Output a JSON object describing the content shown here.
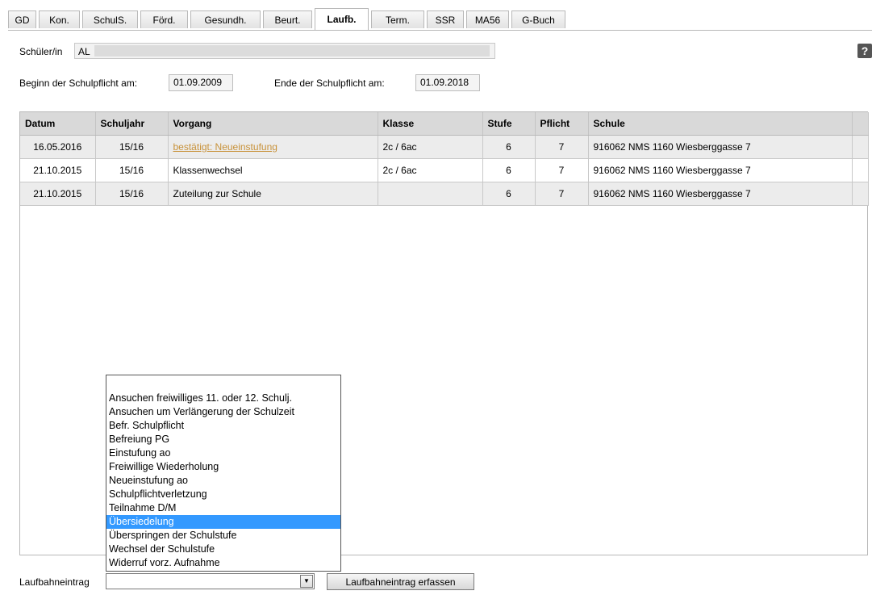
{
  "tabs": [
    {
      "label": "GD"
    },
    {
      "label": "Kon."
    },
    {
      "label": "SchulS."
    },
    {
      "label": "Förd."
    },
    {
      "label": "Gesundh."
    },
    {
      "label": "Beurt."
    },
    {
      "label": "Laufb."
    },
    {
      "label": "Term."
    },
    {
      "label": "SSR"
    },
    {
      "label": "MA56"
    },
    {
      "label": "G-Buch"
    }
  ],
  "active_tab": "Laufb.",
  "student": {
    "label": "Schüler/in",
    "value": "AL"
  },
  "help_icon": "?",
  "schulpflicht": {
    "begin_label": "Beginn der Schulpflicht am:",
    "begin_value": "01.09.2009",
    "end_label": "Ende der Schulpflicht am:",
    "end_value": "01.09.2018"
  },
  "table": {
    "columns": [
      "Datum",
      "Schuljahr",
      "Vorgang",
      "Klasse",
      "Stufe",
      "Pflicht",
      "Schule"
    ],
    "rows": [
      {
        "datum": "16.05.2016",
        "schuljahr": "15/16",
        "vorgang": "bestätigt: Neueinstufung",
        "klasse": "2c / 6ac",
        "stufe": "6",
        "pflicht": "7",
        "schule": "916062 NMS 1160 Wiesberggasse 7"
      },
      {
        "datum": "21.10.2015",
        "schuljahr": "15/16",
        "vorgang": "Klassenwechsel",
        "klasse": "2c / 6ac",
        "stufe": "6",
        "pflicht": "7",
        "schule": "916062 NMS 1160 Wiesberggasse 7"
      },
      {
        "datum": "21.10.2015",
        "schuljahr": "15/16",
        "vorgang": "Zuteilung zur Schule",
        "klasse": "",
        "stufe": "6",
        "pflicht": "7",
        "schule": "916062 NMS 1160 Wiesberggasse 7"
      }
    ]
  },
  "dropdown": {
    "options": [
      "Ansuchen freiwilliges 11. oder 12. Schulj.",
      "Ansuchen um Verlängerung der Schulzeit",
      "Befr. Schulpflicht",
      "Befreiung PG",
      "Einstufung ao",
      "Freiwillige Wiederholung",
      "Neueinstufung ao",
      "Schulpflichtverletzung",
      "Teilnahme D/M",
      "Übersiedelung",
      "Überspringen der Schulstufe",
      "Wechsel der Schulstufe",
      "Widerruf vorz. Aufnahme"
    ],
    "highlighted": "Übersiedelung"
  },
  "laufbahn": {
    "label": "Laufbahneintrag",
    "select_value": "",
    "button_label": "Laufbahneintrag erfassen"
  }
}
